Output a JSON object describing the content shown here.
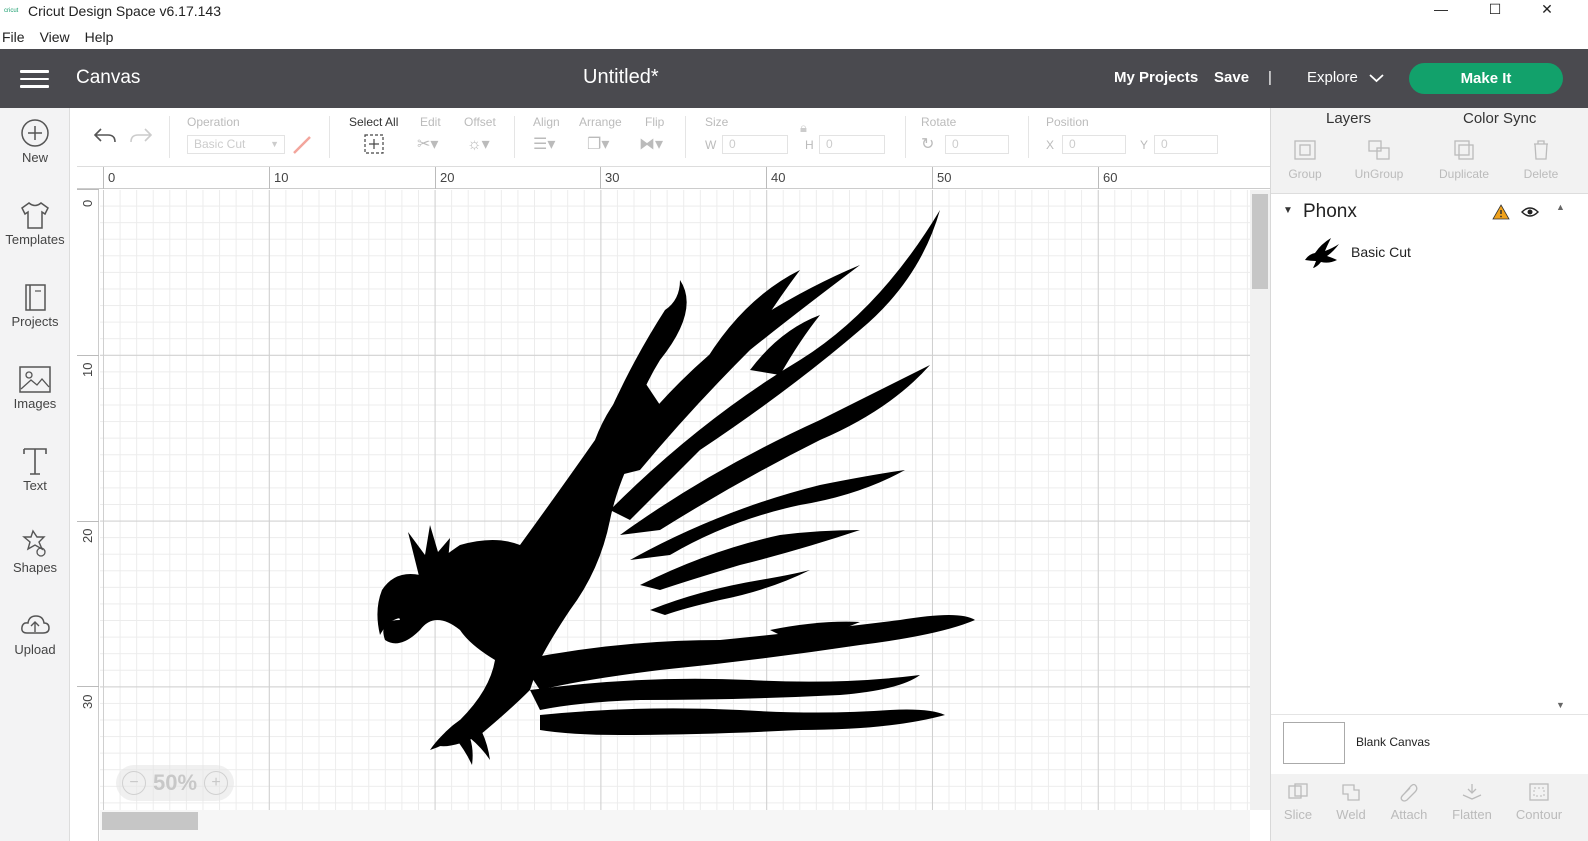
{
  "window": {
    "title": "Cricut Design Space  v6.17.143",
    "logo_text": "cricut",
    "controls": [
      "—",
      "☐",
      "✕"
    ]
  },
  "menu": [
    "File",
    "View",
    "Help"
  ],
  "header": {
    "section": "Canvas",
    "document_title": "Untitled*",
    "my_projects": "My Projects",
    "save": "Save",
    "divider": "|",
    "explore": "Explore",
    "make_it": "Make It"
  },
  "sidebar": [
    {
      "label": "New",
      "icon": "plus-circle-icon"
    },
    {
      "label": "Templates",
      "icon": "tshirt-icon"
    },
    {
      "label": "Projects",
      "icon": "book-icon"
    },
    {
      "label": "Images",
      "icon": "image-icon"
    },
    {
      "label": "Text",
      "icon": "text-t-icon"
    },
    {
      "label": "Shapes",
      "icon": "shapes-icon"
    },
    {
      "label": "Upload",
      "icon": "cloud-upload-icon"
    }
  ],
  "toolbar": {
    "operation_label": "Operation",
    "operation_value": "Basic Cut",
    "select_all": "Select All",
    "edit": "Edit",
    "offset": "Offset",
    "align": "Align",
    "arrange": "Arrange",
    "flip": "Flip",
    "size": "Size",
    "w_label": "W",
    "w_value": "0",
    "h_label": "H",
    "h_value": "0",
    "rotate": "Rotate",
    "rotate_value": "0",
    "position": "Position",
    "x_label": "X",
    "x_value": "0",
    "y_label": "Y",
    "y_value": "0"
  },
  "ruler": {
    "top": [
      "0",
      "10",
      "20",
      "30",
      "40",
      "50",
      "60"
    ],
    "left": [
      "0",
      "10",
      "20",
      "30"
    ]
  },
  "canvas": {
    "zoom": "50%",
    "zoom_out": "−",
    "zoom_in": "+"
  },
  "panel": {
    "tabs": [
      "Layers",
      "Color Sync"
    ],
    "actions": [
      "Group",
      "UnGroup",
      "Duplicate",
      "Delete"
    ],
    "group_name": "Phonx",
    "layer_name": "Basic Cut",
    "blank_canvas": "Blank Canvas",
    "bottom_actions": [
      "Slice",
      "Weld",
      "Attach",
      "Flatten",
      "Contour"
    ]
  },
  "colors": {
    "header_bg": "#4a4a4f",
    "make_it": "#12a16b",
    "warning": "#f0a21c"
  }
}
